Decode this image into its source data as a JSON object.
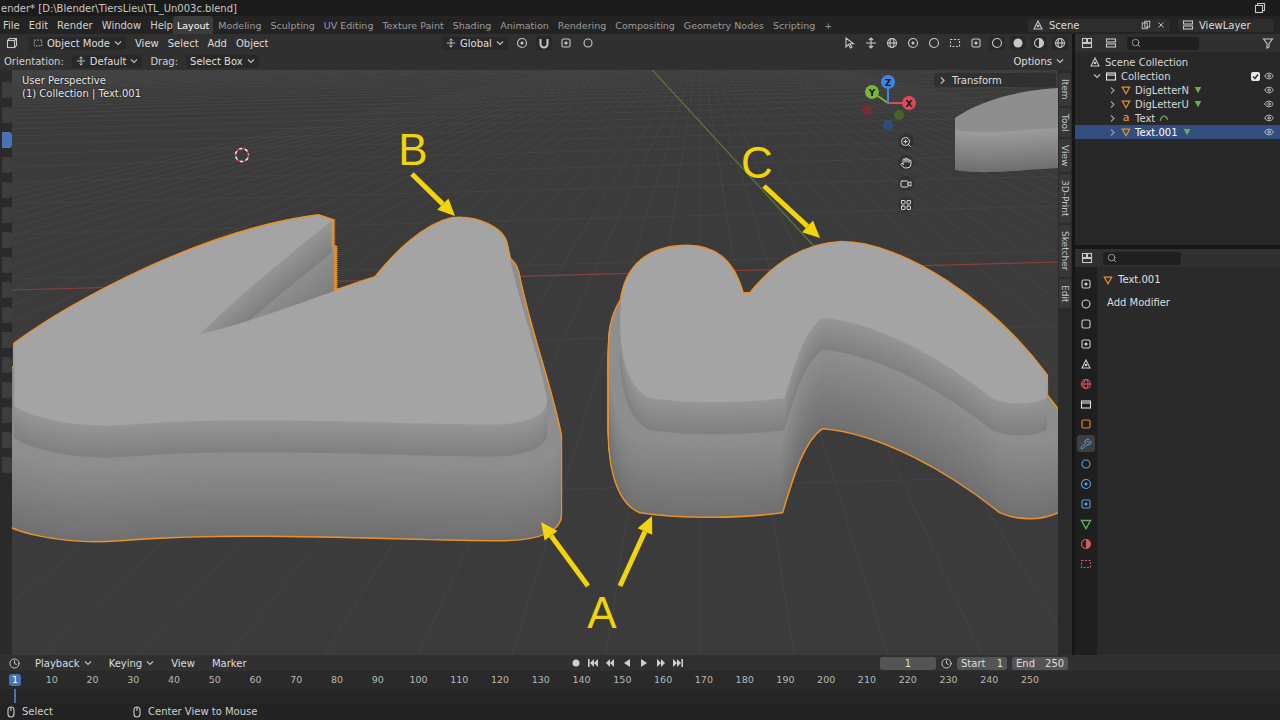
{
  "window": {
    "title": "ender* [D:\\Blender\\TiersLieu\\TL_Un003c.blend]"
  },
  "menu": [
    "File",
    "Edit",
    "Render",
    "Window",
    "Help"
  ],
  "workspaces": [
    {
      "label": "Layout",
      "selected": true
    },
    {
      "label": "Modeling",
      "selected": false
    },
    {
      "label": "Sculpting",
      "selected": false
    },
    {
      "label": "UV Editing",
      "selected": false
    },
    {
      "label": "Texture Paint",
      "selected": false
    },
    {
      "label": "Shading",
      "selected": false
    },
    {
      "label": "Animation",
      "selected": false
    },
    {
      "label": "Rendering",
      "selected": false
    },
    {
      "label": "Compositing",
      "selected": false
    },
    {
      "label": "Geometry Nodes",
      "selected": false
    },
    {
      "label": "Scripting",
      "selected": false
    }
  ],
  "workspace_add": "+",
  "scene": "Scene",
  "view_layer": "ViewLayer",
  "viewport_header": {
    "mode": "Object Mode",
    "menus": [
      "View",
      "Select",
      "Add",
      "Object"
    ],
    "orientation": "Global"
  },
  "tool_settings": {
    "orientation_label": "Orientation:",
    "orientation": "Default",
    "drag_label": "Drag:",
    "drag": "Select Box",
    "options": "Options"
  },
  "toolbar": {
    "tools": [
      {
        "selected": false
      },
      {
        "selected": false
      },
      {
        "selected": true
      },
      {
        "selected": false
      },
      {
        "selected": false
      },
      {
        "selected": false
      },
      {
        "selected": false
      },
      {
        "selected": false
      },
      {
        "selected": false
      },
      {
        "selected": false
      },
      {
        "selected": false
      },
      {
        "selected": false
      },
      {
        "selected": false
      },
      {
        "selected": false
      },
      {
        "selected": false
      },
      {
        "selected": false
      }
    ]
  },
  "viewport": {
    "perspective": "User Perspective",
    "context": "(1) Collection | Text.001",
    "sidebar_tab": "Transform",
    "side_tabs": [
      "Item",
      "Tool",
      "View",
      "3D-Print",
      "Sketcher",
      "Edit"
    ],
    "gizmo": {
      "x": "X",
      "y": "Y",
      "z": "Z"
    }
  },
  "annotations": [
    {
      "label": "A"
    },
    {
      "label": "B"
    },
    {
      "label": "C"
    }
  ],
  "outliner": {
    "root": "Scene Collection",
    "collection": {
      "name": "Collection",
      "checked": true
    },
    "items": [
      {
        "name": "DigLetterN",
        "kind": "mesh",
        "selected": false
      },
      {
        "name": "DigLetterU",
        "kind": "mesh",
        "selected": false
      },
      {
        "name": "Text",
        "kind": "text",
        "glyph": "a",
        "selected": false
      },
      {
        "name": "Text.001",
        "kind": "mesh",
        "selected": true
      }
    ]
  },
  "properties": {
    "object": "Text.001",
    "add_modifier": "Add Modifier",
    "tabs": [
      {
        "selected": false
      },
      {
        "selected": false
      },
      {
        "selected": false
      },
      {
        "selected": false
      },
      {
        "selected": false
      },
      {
        "selected": false
      },
      {
        "selected": false
      },
      {
        "selected": false
      },
      {
        "selected": true
      },
      {
        "selected": false
      },
      {
        "selected": false
      },
      {
        "selected": false
      },
      {
        "selected": false
      },
      {
        "selected": false
      },
      {
        "selected": false
      }
    ]
  },
  "timeline": {
    "menus": [
      {
        "label": "Playback",
        "kind": "dropdown"
      },
      {
        "label": "Keying",
        "kind": "dropdown"
      },
      {
        "label": "View",
        "kind": "menu"
      },
      {
        "label": "Marker",
        "kind": "menu"
      }
    ],
    "current_frame": "1",
    "start_label": "Start",
    "start": "1",
    "end_label": "End",
    "end": "250",
    "ticks": [
      {
        "label": "1",
        "selected": true
      },
      {
        "label": "10",
        "selected": false
      },
      {
        "label": "20",
        "selected": false
      },
      {
        "label": "30",
        "selected": false
      },
      {
        "label": "40",
        "selected": false
      },
      {
        "label": "50",
        "selected": false
      },
      {
        "label": "60",
        "selected": false
      },
      {
        "label": "70",
        "selected": false
      },
      {
        "label": "80",
        "selected": false
      },
      {
        "label": "90",
        "selected": false
      },
      {
        "label": "100",
        "selected": false
      },
      {
        "label": "110",
        "selected": false
      },
      {
        "label": "120",
        "selected": false
      },
      {
        "label": "130",
        "selected": false
      },
      {
        "label": "140",
        "selected": false
      },
      {
        "label": "150",
        "selected": false
      },
      {
        "label": "160",
        "selected": false
      },
      {
        "label": "170",
        "selected": false
      },
      {
        "label": "180",
        "selected": false
      },
      {
        "label": "190",
        "selected": false
      },
      {
        "label": "200",
        "selected": false
      },
      {
        "label": "210",
        "selected": false
      },
      {
        "label": "220",
        "selected": false
      },
      {
        "label": "230",
        "selected": false
      },
      {
        "label": "240",
        "selected": false
      },
      {
        "label": "250",
        "selected": false
      }
    ]
  },
  "status_bar": {
    "items": [
      "Select",
      "Center View to Mouse"
    ]
  }
}
